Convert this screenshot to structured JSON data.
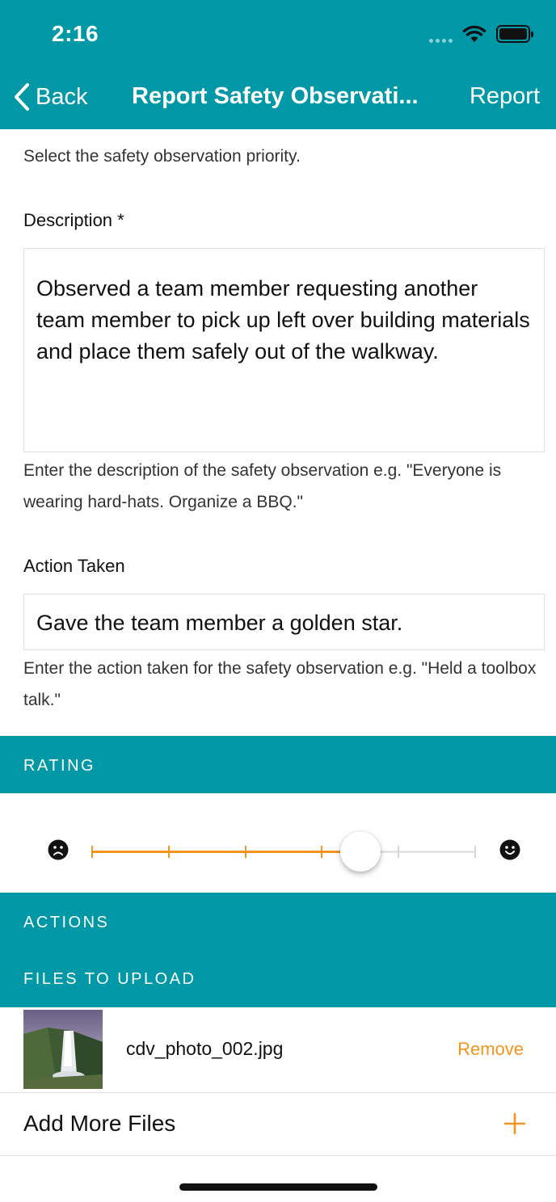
{
  "status_bar": {
    "time": "2:16"
  },
  "nav": {
    "back_label": "Back",
    "title": "Report Safety Observati...",
    "action_label": "Report"
  },
  "priority": {
    "hint": "Select the safety observation priority."
  },
  "description": {
    "label": "Description *",
    "value": "Observed a team member requesting another team member to pick up left over building materials and place them safely out of the walkway.",
    "hint": "Enter the description of the safety observation e.g. \"Everyone is wearing hard-hats. Organize a BBQ.\""
  },
  "action_taken": {
    "label": "Action Taken",
    "value": "Gave the team member a golden star.",
    "hint": "Enter the action taken for the safety observation e.g. \"Held a toolbox talk.\""
  },
  "rating": {
    "section_label": "RATING",
    "value": 3.5,
    "min": 0,
    "max": 5
  },
  "actions": {
    "section_label": "ACTIONS"
  },
  "files": {
    "section_label": "FILES TO UPLOAD",
    "items": [
      {
        "name": "cdv_photo_002.jpg",
        "remove_label": "Remove"
      }
    ],
    "add_label": "Add More Files"
  },
  "colors": {
    "header": "#0097a7",
    "accent": "#f2941d",
    "text": "#111111"
  },
  "icons": {
    "back": "chevron-left-icon",
    "sad": "sad-face-icon",
    "happy": "happy-face-icon",
    "plus": "plus-icon",
    "wifi": "wifi-icon",
    "battery": "battery-icon",
    "signal": "cellular-signal-icon"
  }
}
